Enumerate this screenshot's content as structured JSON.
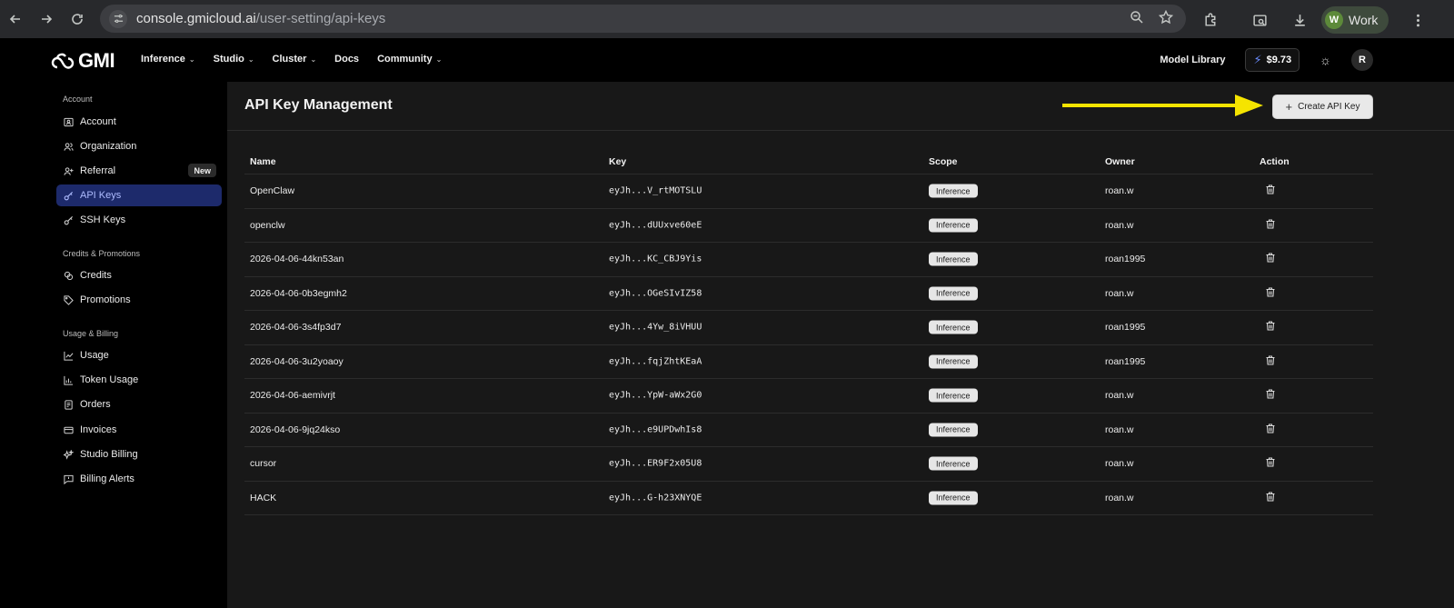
{
  "browser": {
    "url_host": "console.gmicloud.ai",
    "url_path": "/user-setting/api-keys",
    "profile_initial": "W",
    "profile_label": "Work"
  },
  "header": {
    "logo_text": "GMI",
    "nav": [
      "Inference",
      "Studio",
      "Cluster",
      "Docs",
      "Community"
    ],
    "model_library": "Model Library",
    "balance": "$9.73",
    "user_initial": "R"
  },
  "sidebar": {
    "sections": [
      {
        "title": "Account",
        "items": [
          {
            "label": "Account",
            "icon": "id-card-icon"
          },
          {
            "label": "Organization",
            "icon": "users-icon"
          },
          {
            "label": "Referral",
            "icon": "user-plus-icon",
            "badge": "New"
          },
          {
            "label": "API Keys",
            "icon": "key-icon",
            "active": true
          },
          {
            "label": "SSH Keys",
            "icon": "key-icon"
          }
        ]
      },
      {
        "title": "Credits & Promotions",
        "items": [
          {
            "label": "Credits",
            "icon": "coins-icon"
          },
          {
            "label": "Promotions",
            "icon": "tag-icon"
          }
        ]
      },
      {
        "title": "Usage & Billing",
        "items": [
          {
            "label": "Usage",
            "icon": "chart-icon"
          },
          {
            "label": "Token Usage",
            "icon": "bar-chart-icon"
          },
          {
            "label": "Orders",
            "icon": "receipt-icon"
          },
          {
            "label": "Invoices",
            "icon": "credit-card-icon"
          },
          {
            "label": "Studio Billing",
            "icon": "sparkles-icon"
          },
          {
            "label": "Billing Alerts",
            "icon": "message-alert-icon"
          }
        ]
      }
    ]
  },
  "main": {
    "title": "API Key Management",
    "create_button": "Create API Key",
    "columns": [
      "Name",
      "Key",
      "Scope",
      "Owner",
      "Action"
    ],
    "rows": [
      {
        "name": "OpenClaw",
        "key": "eyJh...V_rtMOTSLU",
        "scope": "Inference",
        "owner": "roan.w"
      },
      {
        "name": "openclw",
        "key": "eyJh...dUUxve60eE",
        "scope": "Inference",
        "owner": "roan.w"
      },
      {
        "name": "2026-04-06-44kn53an",
        "key": "eyJh...KC_CBJ9Yis",
        "scope": "Inference",
        "owner": "roan1995"
      },
      {
        "name": "2026-04-06-0b3egmh2",
        "key": "eyJh...OGeSIvIZ58",
        "scope": "Inference",
        "owner": "roan.w"
      },
      {
        "name": "2026-04-06-3s4fp3d7",
        "key": "eyJh...4Yw_8iVHUU",
        "scope": "Inference",
        "owner": "roan1995"
      },
      {
        "name": "2026-04-06-3u2yoaoy",
        "key": "eyJh...fqjZhtKEaA",
        "scope": "Inference",
        "owner": "roan1995"
      },
      {
        "name": "2026-04-06-aemivrjt",
        "key": "eyJh...YpW-aWx2G0",
        "scope": "Inference",
        "owner": "roan.w"
      },
      {
        "name": "2026-04-06-9jq24kso",
        "key": "eyJh...e9UPDwhIs8",
        "scope": "Inference",
        "owner": "roan.w"
      },
      {
        "name": "cursor",
        "key": "eyJh...ER9F2x05U8",
        "scope": "Inference",
        "owner": "roan.w"
      },
      {
        "name": "HACK",
        "key": "eyJh...G-h23XNYQE",
        "scope": "Inference",
        "owner": "roan.w"
      }
    ]
  },
  "annotation": {
    "arrow_color": "#f5e400"
  }
}
